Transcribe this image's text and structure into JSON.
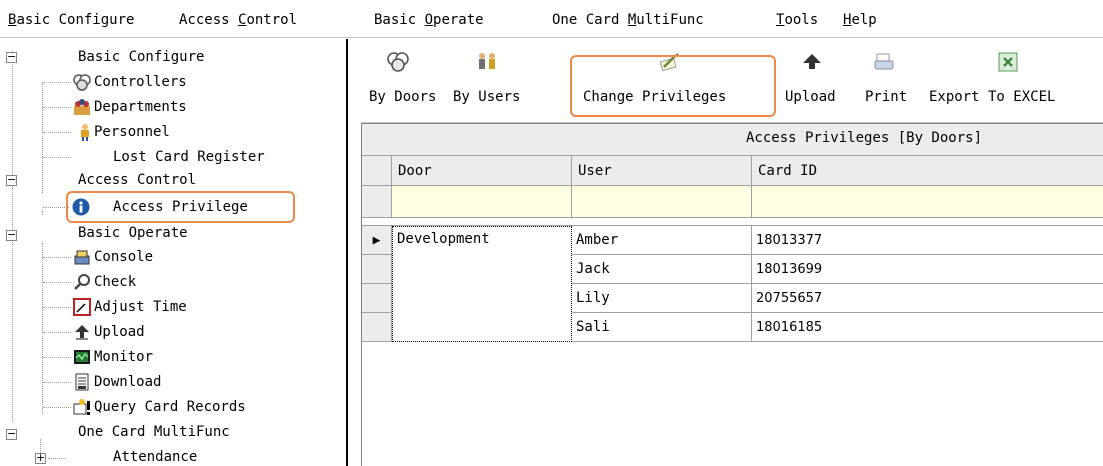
{
  "menu": [
    {
      "before": "",
      "u": "B",
      "after": "asic Configure"
    },
    {
      "before": "Access ",
      "u": "C",
      "after": "ontrol"
    },
    {
      "before": "Basic ",
      "u": "O",
      "after": "perate"
    },
    {
      "before": "One Card ",
      "u": "M",
      "after": "ultiFunc"
    },
    {
      "before": "",
      "u": "T",
      "after": "ools"
    },
    {
      "before": "",
      "u": "H",
      "after": "elp"
    }
  ],
  "tree": {
    "basic_configure": "Basic Configure",
    "controllers": "Controllers",
    "departments": "Departments",
    "personnel": "Personnel",
    "lost_card_register": "Lost Card Register",
    "access_control": "Access Control",
    "access_privilege": "Access Privilege",
    "basic_operate": "Basic Operate",
    "console": "Console",
    "check": "Check",
    "adjust_time": "Adjust Time",
    "upload": "Upload",
    "monitor": "Monitor",
    "download": "Download",
    "query_card_records": "Query Card Records",
    "one_card_multifunc": "One Card MultiFunc",
    "attendance": "Attendance",
    "expander_minus": "−",
    "expander_plus": "+"
  },
  "toolbar": {
    "by_doors": "By Doors",
    "by_users": "By Users",
    "change_privileges": "Change Privileges",
    "upload": "Upload",
    "print": "Print",
    "export": "Export To EXCEL"
  },
  "grid": {
    "caption": "Access Privileges [By Doors]",
    "columns": [
      "Door",
      "User",
      "Card ID"
    ],
    "row_indicator": "▶",
    "door": "Development",
    "rows": [
      {
        "user": "Amber",
        "card_id": "18013377"
      },
      {
        "user": "Jack",
        "card_id": "18013699"
      },
      {
        "user": "Lily",
        "card_id": "20755657"
      },
      {
        "user": "Sali",
        "card_id": "18016185"
      }
    ]
  },
  "colors": {
    "highlight": "#f08848",
    "info_icon": "#1e5aa8",
    "filter_row": "#ffffe1"
  }
}
